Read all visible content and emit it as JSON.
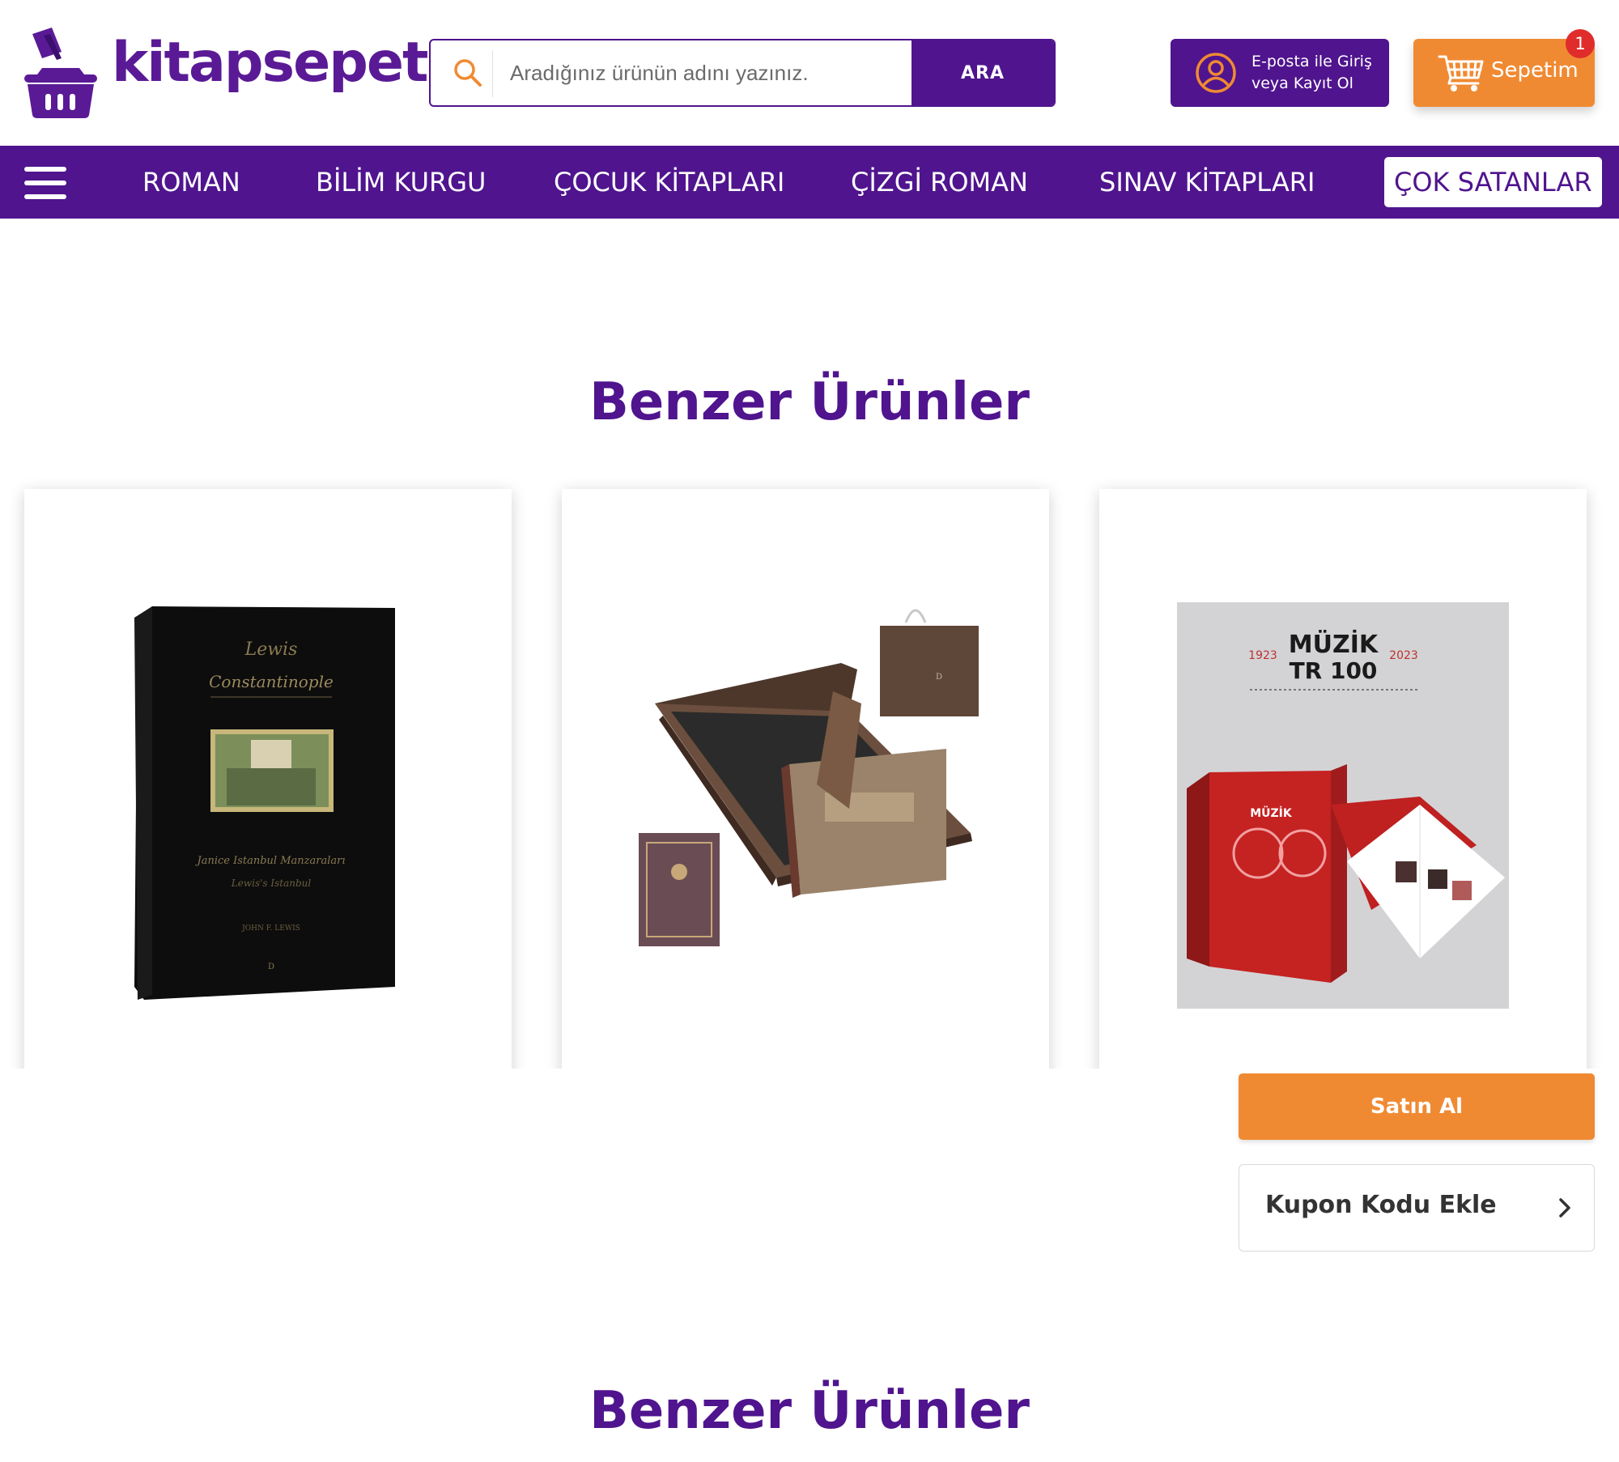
{
  "brand": {
    "name": "kitapsepeti",
    "color": "#5a1a96"
  },
  "search": {
    "placeholder": "Aradığınız ürünün adını yazınız.",
    "button_label": "ARA",
    "icon": "search-icon"
  },
  "account": {
    "line1": "E-posta ile Giriş",
    "line2": "veya Kayıt Ol",
    "icon": "user-circle-icon"
  },
  "cart": {
    "label": "Sepetim",
    "badge_count": "1",
    "icon": "shopping-cart-icon"
  },
  "nav": {
    "menu_icon": "hamburger-menu-icon",
    "items": [
      {
        "label": "ROMAN"
      },
      {
        "label": "BİLİM KURGU"
      },
      {
        "label": "ÇOCUK KİTAPLARI"
      },
      {
        "label": "ÇİZGİ ROMAN"
      },
      {
        "label": "SINAV KİTAPLARI"
      },
      {
        "label": "ÇOK SATANLAR",
        "active": true
      }
    ]
  },
  "sections": {
    "similar_title": "Benzer Ürünler",
    "similar_title_2": "Benzer Ürünler"
  },
  "products": [
    {
      "image": "lewis-constantinople-book-cover"
    },
    {
      "image": "boxed-collector-edition-set"
    },
    {
      "image": "muzik-tr-100-box-set",
      "cover_title": "MÜZİK",
      "cover_subtitle": "TR 100",
      "cover_year_left": "1923",
      "cover_year_right": "2023"
    }
  ],
  "actions": {
    "buy_label": "Satın Al",
    "coupon_label": "Kupon Kodu Ekle",
    "coupon_icon": "chevron-right-icon"
  },
  "colors": {
    "primary": "#4f148e",
    "accent": "#f08a32",
    "badge": "#e12c2c"
  }
}
